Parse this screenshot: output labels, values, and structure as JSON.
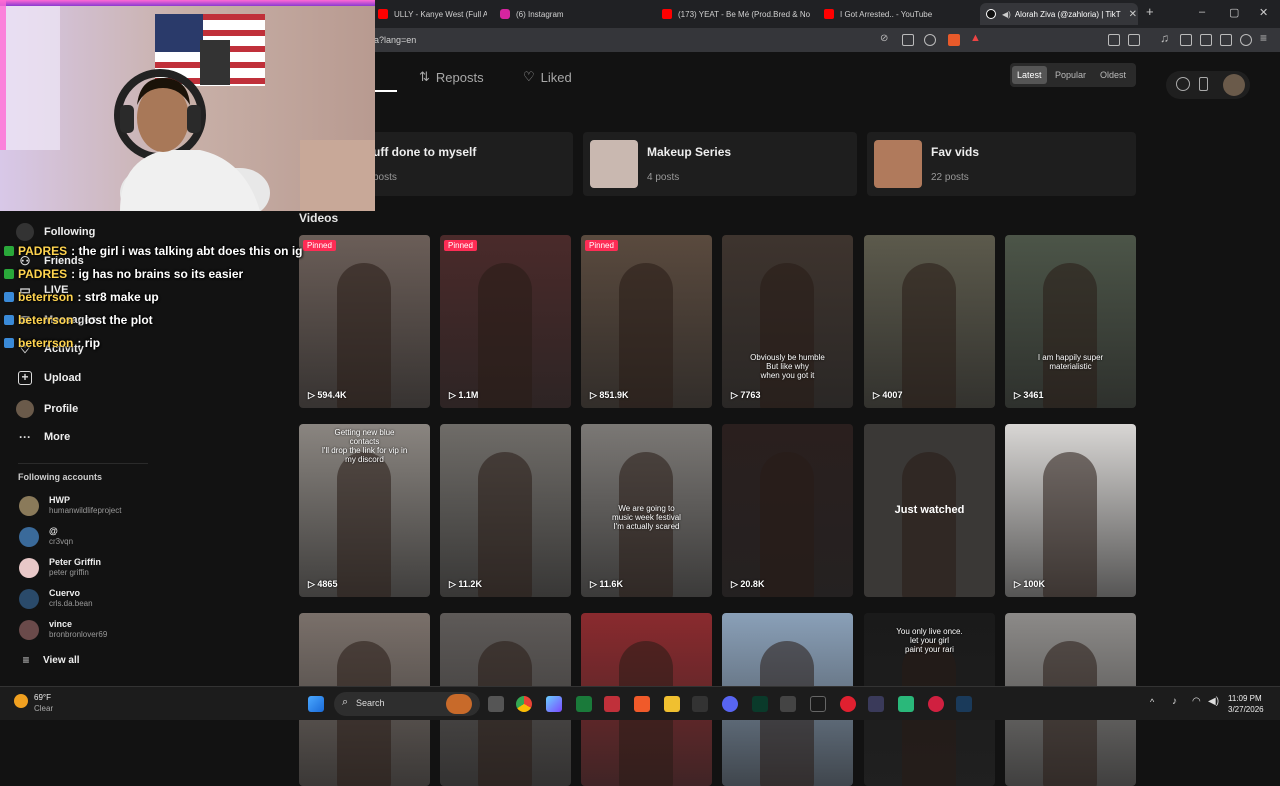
{
  "browser": {
    "tabs": [
      {
        "title": "ULLY - Kanye West (Full Album",
        "icon": "youtube-icon",
        "color": "#ff0000"
      },
      {
        "title": "(6) Instagram",
        "icon": "instagram-icon",
        "color": "#d6249f"
      },
      {
        "title": "(173) YEAT - Be Mé (Prod.Bred & No",
        "icon": "youtube-icon",
        "color": "#ff0000"
      },
      {
        "title": "I Got Arrested.. - YouTube",
        "icon": "youtube-icon",
        "color": "#ff0000"
      },
      {
        "title": "Alorah Ziva (@zahloria) | TikT",
        "icon": "tiktok-icon",
        "color": "#ffffff"
      }
    ],
    "new_tab": "+",
    "url": "ia?lang=en",
    "window_controls": [
      "–",
      "▢",
      "✕"
    ]
  },
  "profile": {
    "tabs": [
      {
        "label": "Reposts",
        "icon": "repost-icon"
      },
      {
        "label": "Liked",
        "icon": "heart-icon"
      }
    ],
    "sort": [
      "Latest",
      "Popular",
      "Oldest"
    ],
    "sort_selected": "Latest"
  },
  "collections": [
    {
      "title": "uff done to myself",
      "subtitle": "posts",
      "thumb": ""
    },
    {
      "title": "Makeup Series",
      "subtitle": "4 posts",
      "thumb": "#c9b8b0"
    },
    {
      "title": "Fav vids",
      "subtitle": "22 posts",
      "thumb": "#b07a5c"
    }
  ],
  "videos_heading": "Videos",
  "videos": [
    {
      "count": "594.4K",
      "badge": "Pinned",
      "caption": "",
      "bg": "#6b5e58"
    },
    {
      "count": "1.1M",
      "badge": "Pinned",
      "caption": "",
      "bg": "#4a2a2a"
    },
    {
      "count": "851.9K",
      "badge": "Pinned",
      "caption": "",
      "bg": "#5a4a3e"
    },
    {
      "count": "7763",
      "badge": "",
      "caption": "Obviously be humble\nBut like why\nwhen you got it",
      "bg": "#3e342e"
    },
    {
      "count": "4007",
      "badge": "",
      "caption": "",
      "bg": "#5c5a4c"
    },
    {
      "count": "3461",
      "badge": "",
      "caption": "I am happily super\nmaterialistic",
      "bg": "#4c5548"
    },
    {
      "count": "4865",
      "badge": "",
      "caption": "Getting new blue\ncontacts\nI'll drop the link for vip in\nmy discord",
      "bg": "#8a8580"
    },
    {
      "count": "11.2K",
      "badge": "",
      "caption": "",
      "bg": "#6f6c68"
    },
    {
      "count": "11.6K",
      "badge": "",
      "caption": "We are going to\nmusic week festival\nI'm actually scared",
      "bg": "#7b7875"
    },
    {
      "count": "20.8K",
      "badge": "",
      "caption": "",
      "bg": "#2a1f1e"
    },
    {
      "count": "",
      "badge": "",
      "caption": "",
      "bg": "#3a3836",
      "watched": "Just watched"
    },
    {
      "count": "100K",
      "badge": "",
      "caption": "",
      "bg": "#d8d6d4"
    },
    {
      "count": "",
      "badge": "",
      "caption": "",
      "bg": "#7a706a"
    },
    {
      "count": "",
      "badge": "",
      "caption": "",
      "bg": "#5e5a58"
    },
    {
      "count": "",
      "badge": "",
      "caption": "",
      "bg": "#8a2a2e"
    },
    {
      "count": "",
      "badge": "",
      "caption": "",
      "bg": "#8aa0b8"
    },
    {
      "count": "",
      "badge": "",
      "caption": "You only live once.\nlet your girl\npaint your rari",
      "bg": "#1a1a1a"
    },
    {
      "count": "",
      "badge": "",
      "caption": "",
      "bg": "#8c8a88"
    }
  ],
  "sidebar": {
    "nav": [
      {
        "label": "Following",
        "icon": "following-icon"
      },
      {
        "label": "Friends",
        "icon": "friends-icon"
      },
      {
        "label": "LIVE",
        "icon": "live-icon"
      },
      {
        "label": "Messages",
        "icon": "messages-icon"
      },
      {
        "label": "Activity",
        "icon": "activity-icon"
      },
      {
        "label": "Upload",
        "icon": "upload-icon"
      },
      {
        "label": "Profile",
        "icon": "profile-icon"
      },
      {
        "label": "More",
        "icon": "more-icon"
      }
    ],
    "following_accounts_label": "Following accounts",
    "accounts": [
      {
        "name": "HWP",
        "handle": "humanwildlifeproject",
        "color": "#8a7a5a"
      },
      {
        "name": "@",
        "handle": "cr3vqn",
        "color": "#3a6a9a"
      },
      {
        "name": "Peter Griffin",
        "handle": "peter griffin",
        "color": "#e8c8c8"
      },
      {
        "name": "Cuervo",
        "handle": "crls.da.bean",
        "color": "#2a4a6a"
      },
      {
        "name": "vince",
        "handle": "bronbronlover69",
        "color": "#6a4a4a"
      }
    ],
    "view_all": "View all"
  },
  "chat": [
    {
      "user": "PADRES",
      "message": ": the girl i was talking abt does this on ig"
    },
    {
      "user": "PADRES",
      "message": ": ig has no brains so its easier"
    },
    {
      "user": "beterrson",
      "message": ": str8 make up"
    },
    {
      "user": "beterrson",
      "message": ": lost the plot"
    },
    {
      "user": "beterrson",
      "message": ": rip"
    }
  ],
  "taskbar": {
    "weather_temp": "69°F",
    "weather_desc": "Clear",
    "search_placeholder": "Search",
    "time": "11:09 PM",
    "date": "3/27/2026"
  }
}
